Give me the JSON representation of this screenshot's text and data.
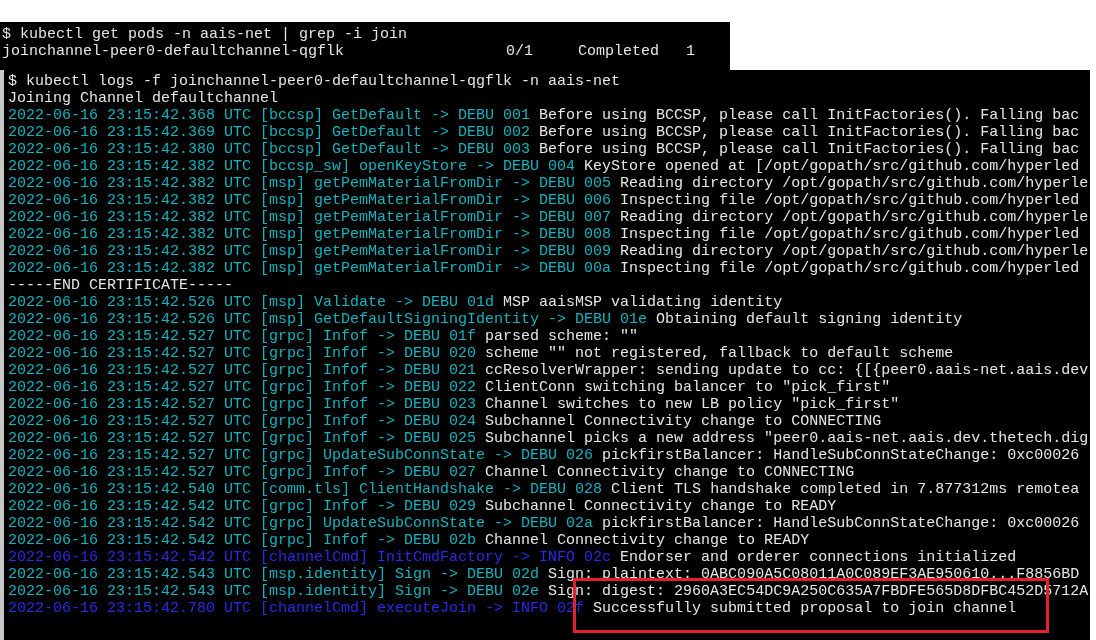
{
  "pods_terminal": {
    "command": "$ kubectl get pods -n aais-net | grep -i join",
    "row": [
      "joinchannel-peer0-defaultchannel-qgflk",
      "0/1",
      "Completed",
      "1"
    ]
  },
  "logs_terminal": {
    "command": "$ kubectl logs -f joinchannel-peer0-defaultchannel-qgflk -n aais-net",
    "lines": [
      {
        "kind": "plain",
        "message": "Joining Channel defaultchannel"
      },
      {
        "kind": "debug",
        "prefix": "2022-06-16 23:15:42.368 UTC [bccsp] GetDefault -> DEBU 001",
        "message": "Before using BCCSP, please call InitFactories(). Falling bac"
      },
      {
        "kind": "debug",
        "prefix": "2022-06-16 23:15:42.369 UTC [bccsp] GetDefault -> DEBU 002",
        "message": "Before using BCCSP, please call InitFactories(). Falling bac"
      },
      {
        "kind": "debug",
        "prefix": "2022-06-16 23:15:42.380 UTC [bccsp] GetDefault -> DEBU 003",
        "message": "Before using BCCSP, please call InitFactories(). Falling bac"
      },
      {
        "kind": "debug",
        "prefix": "2022-06-16 23:15:42.382 UTC [bccsp_sw] openKeyStore -> DEBU 004",
        "message": "KeyStore opened at [/opt/gopath/src/github.com/hyperled"
      },
      {
        "kind": "debug",
        "prefix": "2022-06-16 23:15:42.382 UTC [msp] getPemMaterialFromDir -> DEBU 005",
        "message": "Reading directory /opt/gopath/src/github.com/hyperle"
      },
      {
        "kind": "debug",
        "prefix": "2022-06-16 23:15:42.382 UTC [msp] getPemMaterialFromDir -> DEBU 006",
        "message": "Inspecting file /opt/gopath/src/github.com/hyperled"
      },
      {
        "kind": "debug",
        "prefix": "2022-06-16 23:15:42.382 UTC [msp] getPemMaterialFromDir -> DEBU 007",
        "message": "Reading directory /opt/gopath/src/github.com/hyperle"
      },
      {
        "kind": "debug",
        "prefix": "2022-06-16 23:15:42.382 UTC [msp] getPemMaterialFromDir -> DEBU 008",
        "message": "Inspecting file /opt/gopath/src/github.com/hyperled"
      },
      {
        "kind": "debug",
        "prefix": "2022-06-16 23:15:42.382 UTC [msp] getPemMaterialFromDir -> DEBU 009",
        "message": "Reading directory /opt/gopath/src/github.com/hyperle"
      },
      {
        "kind": "debug",
        "prefix": "2022-06-16 23:15:42.382 UTC [msp] getPemMaterialFromDir -> DEBU 00a",
        "message": "Inspecting file /opt/gopath/src/github.com/hyperled"
      },
      {
        "kind": "plain",
        "message": "-----END CERTIFICATE-----"
      },
      {
        "kind": "debug",
        "prefix": "2022-06-16 23:15:42.526 UTC [msp] Validate -> DEBU 01d",
        "message": "MSP aaisMSP validating identity"
      },
      {
        "kind": "debug",
        "prefix": "2022-06-16 23:15:42.526 UTC [msp] GetDefaultSigningIdentity -> DEBU 01e",
        "message": "Obtaining default signing identity"
      },
      {
        "kind": "debug",
        "prefix": "2022-06-16 23:15:42.527 UTC [grpc] Infof -> DEBU 01f",
        "message": "parsed scheme: \"\""
      },
      {
        "kind": "debug",
        "prefix": "2022-06-16 23:15:42.527 UTC [grpc] Infof -> DEBU 020",
        "message": "scheme \"\" not registered, fallback to default scheme"
      },
      {
        "kind": "debug",
        "prefix": "2022-06-16 23:15:42.527 UTC [grpc] Infof -> DEBU 021",
        "message": "ccResolverWrapper: sending update to cc: {[{peer0.aais-net.aais.dev"
      },
      {
        "kind": "debug",
        "prefix": "2022-06-16 23:15:42.527 UTC [grpc] Infof -> DEBU 022",
        "message": "ClientConn switching balancer to \"pick_first\""
      },
      {
        "kind": "debug",
        "prefix": "2022-06-16 23:15:42.527 UTC [grpc] Infof -> DEBU 023",
        "message": "Channel switches to new LB policy \"pick_first\""
      },
      {
        "kind": "debug",
        "prefix": "2022-06-16 23:15:42.527 UTC [grpc] Infof -> DEBU 024",
        "message": "Subchannel Connectivity change to CONNECTING"
      },
      {
        "kind": "debug",
        "prefix": "2022-06-16 23:15:42.527 UTC [grpc] Infof -> DEBU 025",
        "message": "Subchannel picks a new address \"peer0.aais-net.aais.dev.thetech.dig"
      },
      {
        "kind": "debug",
        "prefix": "2022-06-16 23:15:42.527 UTC [grpc] UpdateSubConnState -> DEBU 026",
        "message": "pickfirstBalancer: HandleSubConnStateChange: 0xc00026"
      },
      {
        "kind": "debug",
        "prefix": "2022-06-16 23:15:42.527 UTC [grpc] Infof -> DEBU 027",
        "message": "Channel Connectivity change to CONNECTING"
      },
      {
        "kind": "debug",
        "prefix": "2022-06-16 23:15:42.540 UTC [comm.tls] ClientHandshake -> DEBU 028",
        "message": "Client TLS handshake completed in 7.877312ms remotea"
      },
      {
        "kind": "debug",
        "prefix": "2022-06-16 23:15:42.542 UTC [grpc] Infof -> DEBU 029",
        "message": "Subchannel Connectivity change to READY"
      },
      {
        "kind": "debug",
        "prefix": "2022-06-16 23:15:42.542 UTC [grpc] UpdateSubConnState -> DEBU 02a",
        "message": "pickfirstBalancer: HandleSubConnStateChange: 0xc00026"
      },
      {
        "kind": "debug",
        "prefix": "2022-06-16 23:15:42.542 UTC [grpc] Infof -> DEBU 02b",
        "message": "Channel Connectivity change to READY"
      },
      {
        "kind": "info",
        "prefix": "2022-06-16 23:15:42.542 UTC [channelCmd] InitCmdFactory -> INFO 02c",
        "message": "Endorser and orderer connections initialized"
      },
      {
        "kind": "debug",
        "prefix": "2022-06-16 23:15:42.543 UTC [msp.identity] Sign -> DEBU 02d",
        "message": "Sign: plaintext: 0ABC090A5C08011A0C089EF3AE950610...F8856BD"
      },
      {
        "kind": "debug",
        "prefix": "2022-06-16 23:15:42.543 UTC [msp.identity] Sign -> DEBU 02e",
        "message": "Sign: digest: 2960A3EC54DC9A250C635A7FBDFE565D8DFBC452D5712A"
      },
      {
        "kind": "info",
        "prefix": "2022-06-16 23:15:42.780 UTC [channelCmd] executeJoin -> INFO 02f",
        "message": "Successfully submitted proposal to join channel"
      }
    ]
  },
  "annotation": {
    "kind": "rectangle",
    "color": "#e5202b"
  }
}
